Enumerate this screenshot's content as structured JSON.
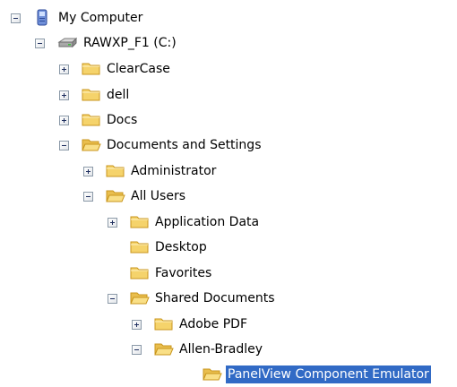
{
  "tree": {
    "root": {
      "label": "My Computer",
      "expanded": true,
      "icon": "my-computer-icon"
    },
    "drive": {
      "label": "RAWXP_F1 (C:)",
      "expanded": true,
      "icon": "hard-drive-icon"
    },
    "folders": [
      {
        "key": "clearcase",
        "label": "ClearCase",
        "expanded": false,
        "has_children": true
      },
      {
        "key": "dell",
        "label": "dell",
        "expanded": false,
        "has_children": true
      },
      {
        "key": "docs",
        "label": "Docs",
        "expanded": false,
        "has_children": true
      },
      {
        "key": "documents-and-settings",
        "label": "Documents and Settings",
        "expanded": true,
        "has_children": true
      },
      {
        "key": "administrator",
        "label": "Administrator",
        "expanded": false,
        "has_children": true
      },
      {
        "key": "all-users",
        "label": "All Users",
        "expanded": true,
        "has_children": true
      },
      {
        "key": "application-data",
        "label": "Application Data",
        "expanded": false,
        "has_children": true
      },
      {
        "key": "desktop",
        "label": "Desktop",
        "expanded": false,
        "has_children": false
      },
      {
        "key": "favorites",
        "label": "Favorites",
        "expanded": false,
        "has_children": false
      },
      {
        "key": "shared-documents",
        "label": "Shared Documents",
        "expanded": true,
        "has_children": true
      },
      {
        "key": "adobe-pdf",
        "label": "Adobe PDF",
        "expanded": false,
        "has_children": true
      },
      {
        "key": "allen-bradley",
        "label": "Allen-Bradley",
        "expanded": true,
        "has_children": true
      },
      {
        "key": "panelview-component-emulator",
        "label": "PanelView Component Emulator",
        "expanded": false,
        "has_children": false,
        "selected": true
      }
    ]
  },
  "colors": {
    "selection": "#316ac5",
    "folder": "#f5d36b",
    "folder_dark": "#c9961c"
  }
}
